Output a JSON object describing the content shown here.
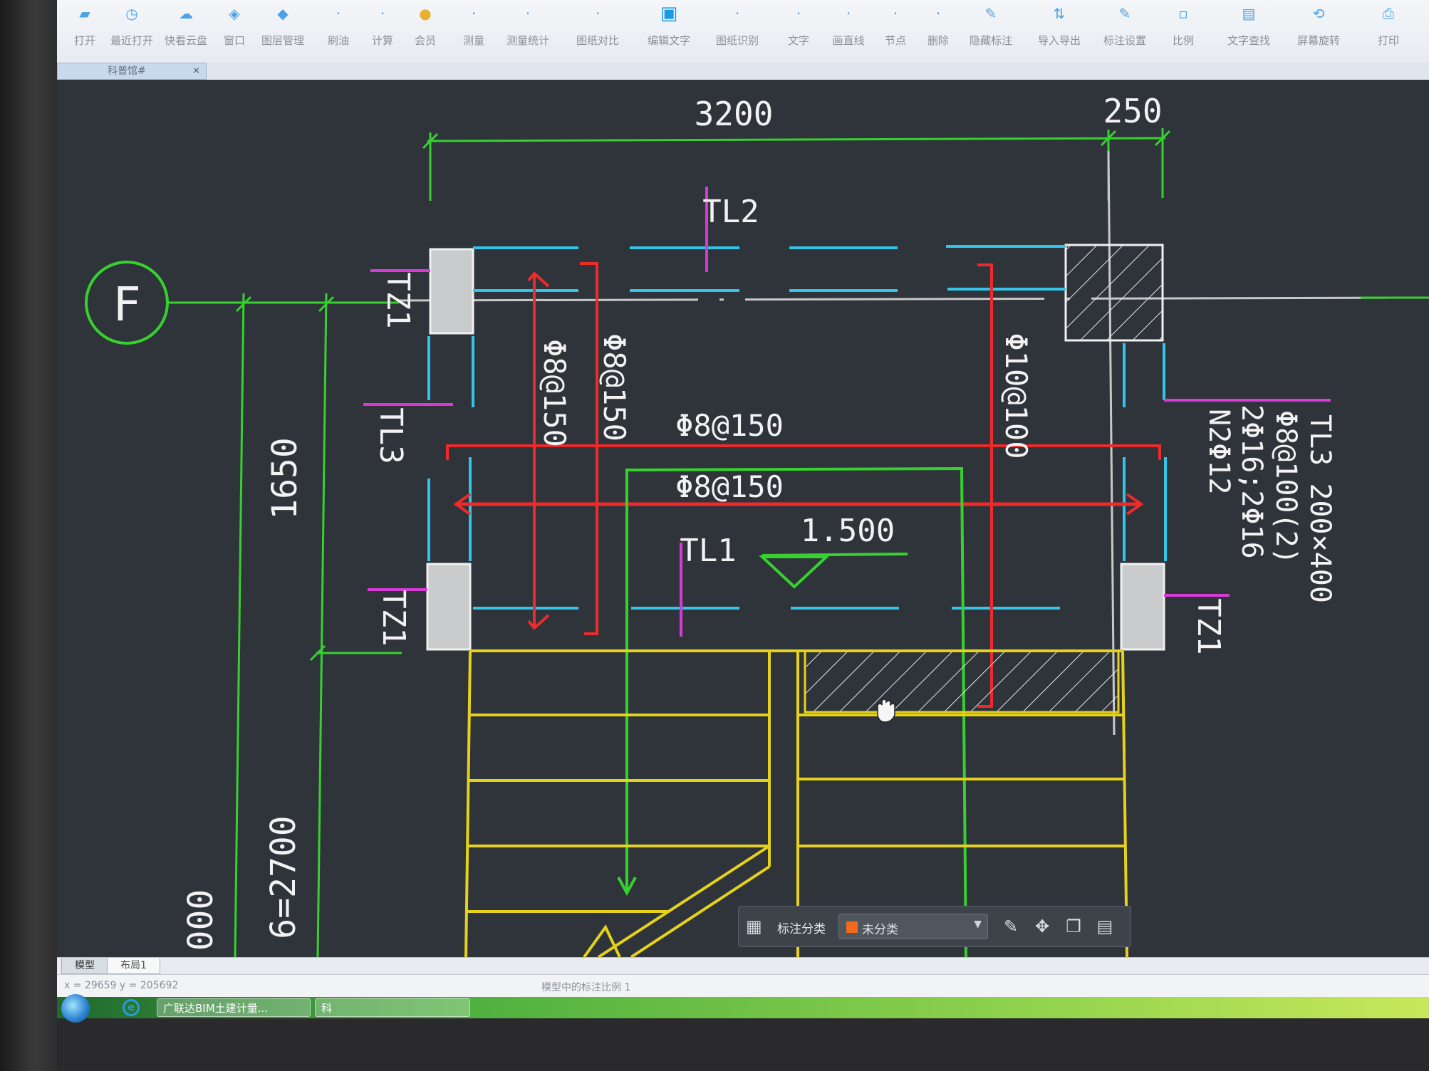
{
  "ribbon": {
    "tools": [
      {
        "label": "打开",
        "icon": "folder-icon"
      },
      {
        "label": "最近打开",
        "icon": "clock-icon"
      },
      {
        "label": "快看云盘",
        "icon": "cloud-icon"
      },
      {
        "label": "窗口",
        "icon": "window-icon"
      },
      {
        "label": "图层管理",
        "icon": "layers-icon"
      },
      {
        "label": "刷油",
        "icon": "brush-icon"
      },
      {
        "label": "计算",
        "icon": "calc-icon"
      },
      {
        "label": "会员",
        "icon": "vip-icon"
      },
      {
        "label": "测量",
        "icon": "ruler-icon"
      },
      {
        "label": "测量统计",
        "icon": "stats-icon"
      },
      {
        "label": "图纸对比",
        "icon": "compare-icon"
      },
      {
        "label": "编辑文字",
        "icon": "edit-text-icon"
      },
      {
        "label": "图纸识别",
        "icon": "recognize-icon"
      },
      {
        "label": "文字",
        "icon": "text-icon"
      },
      {
        "label": "画直线",
        "icon": "line-icon"
      },
      {
        "label": "节点",
        "icon": "node-icon"
      },
      {
        "label": "删除",
        "icon": "delete-icon"
      },
      {
        "label": "隐藏标注",
        "icon": "hide-icon"
      },
      {
        "label": "导入导出",
        "icon": "import-export-icon"
      },
      {
        "label": "标注设置",
        "icon": "annotate-settings-icon"
      },
      {
        "label": "比例",
        "icon": "scale-icon"
      },
      {
        "label": "文字查找",
        "icon": "find-text-icon"
      },
      {
        "label": "屏幕旋转",
        "icon": "rotate-icon"
      },
      {
        "label": "打印",
        "icon": "print-icon"
      }
    ]
  },
  "document_tab": {
    "label": "科普馆#",
    "close": "×"
  },
  "drawing": {
    "dimension_main": "3200",
    "dimension_side": "250",
    "grid_axis": "F",
    "label_tl2": "TL2",
    "label_tz1_a": "TZ1",
    "label_tl3": "TL3",
    "label_tz1_b": "TZ1",
    "label_tz1_c": "TZ1",
    "label_tl1": "TL1",
    "rebar_v1": "Φ8@150",
    "rebar_v2": "Φ8@150",
    "rebar_v3": "Φ10@100",
    "rebar_h1": "Φ8@150",
    "rebar_h2": "Φ8@150",
    "elevation": "1.500",
    "dim_left": "1650",
    "dim_bottom_a": "6=2700",
    "dim_bottom_b": "000",
    "beam_note": {
      "line1": "TL3 200×400",
      "line2": "Φ8@100(2)",
      "line3": "2Φ16;2Φ16",
      "line4": "N2Φ12"
    }
  },
  "float_bar": {
    "label": "标注分类",
    "dropdown_value": "未分类",
    "dropdown_color": "#f26b1d"
  },
  "layout_tabs": [
    "模型",
    "布局1"
  ],
  "status": {
    "coords": "x = 29659  y = 205692",
    "scale_note": "模型中的标注比例 1"
  },
  "taskbar": {
    "item1": "广联达BIM土建计量...",
    "item2": "科"
  },
  "colors": {
    "green": "#37d12f",
    "cyan": "#33c4e8",
    "magenta": "#d83ad6",
    "red": "#ee2a2a",
    "yellow": "#e6d21a",
    "white": "#f2f2f2",
    "background": "#2f343b"
  }
}
